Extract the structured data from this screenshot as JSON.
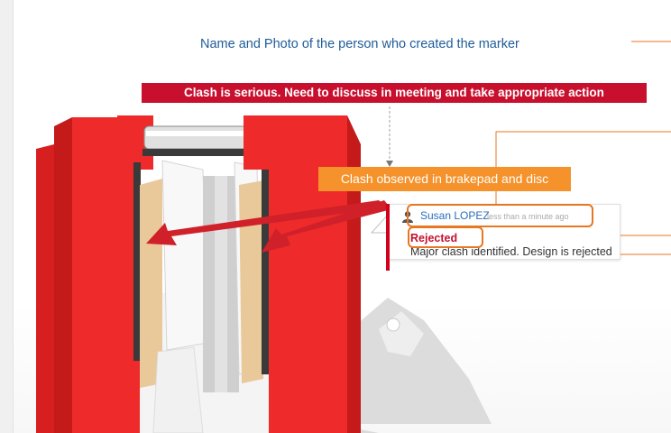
{
  "annotations": {
    "caption": "Name and Photo of the person who created the marker"
  },
  "markers": {
    "serious_note": "Clash is serious. Need to discuss in meeting and take appropriate action",
    "observed_note": "Clash observed in brakepad and disc"
  },
  "comment": {
    "author": "Susan LOPEZ",
    "time": "less than a minute ago",
    "status": "Rejected",
    "message": "Major clash identified. Design is rejected"
  },
  "colors": {
    "caliper_red": "#ee2a2a",
    "serious_red": "#c8102e",
    "observed_orange": "#f5922b",
    "highlight_orange": "#e87722",
    "caption_blue": "#1f5c99",
    "arrow_red": "#d0202a"
  }
}
